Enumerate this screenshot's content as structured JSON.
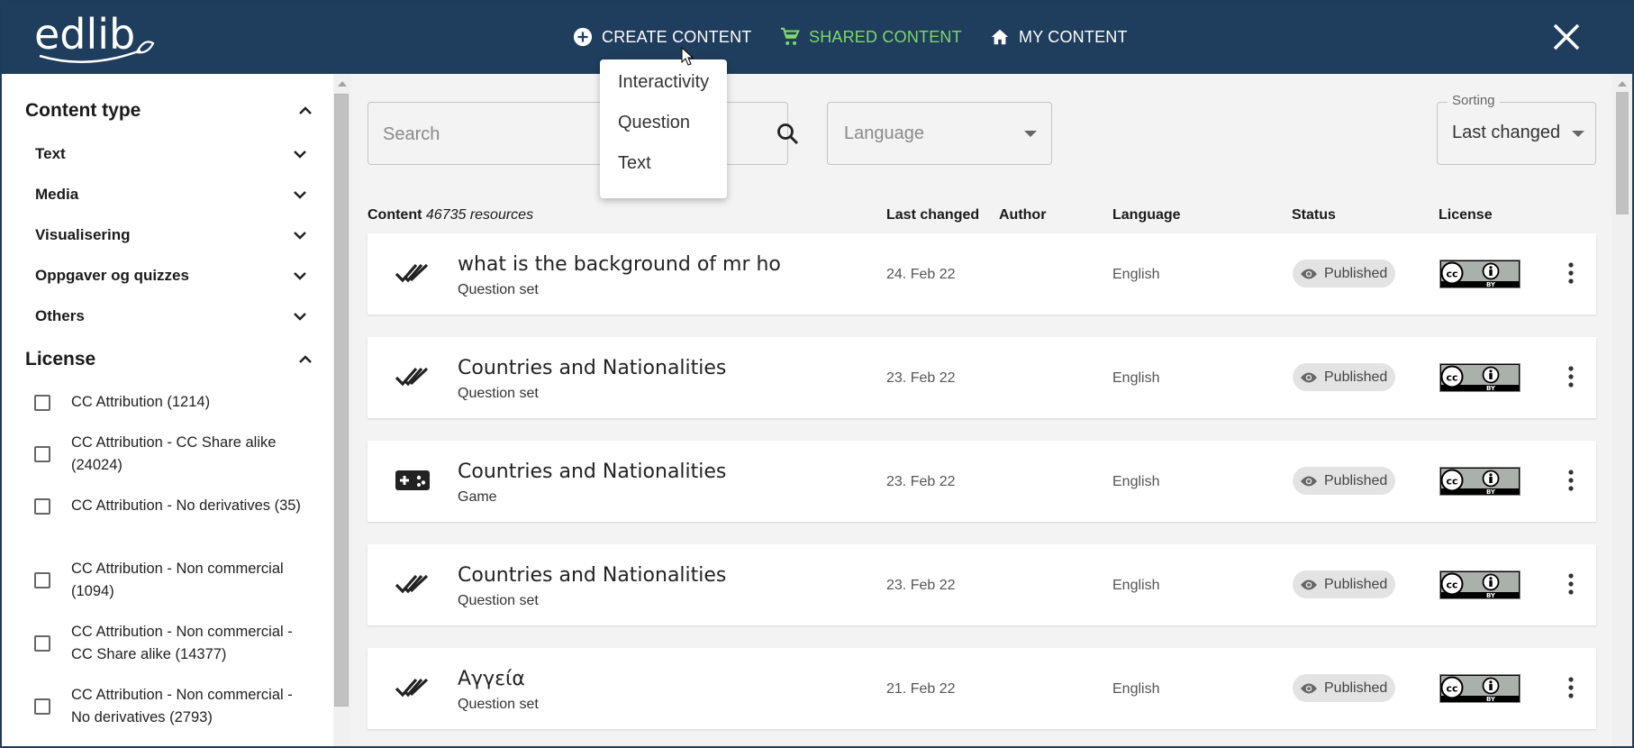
{
  "header": {
    "logo_text": "edlib",
    "nav": {
      "create": "CREATE CONTENT",
      "shared": "SHARED CONTENT",
      "mine": "MY CONTENT"
    }
  },
  "dropdown": {
    "items": [
      "Interactivity",
      "Question",
      "Text"
    ]
  },
  "sidebar": {
    "content_type": {
      "title": "Content type",
      "items": [
        "Text",
        "Media",
        "Visualisering",
        "Oppgaver og quizzes",
        "Others"
      ]
    },
    "license": {
      "title": "License",
      "items": [
        "CC Attribution (1214)",
        "CC Attribution - CC Share alike (24024)",
        "CC Attribution - No derivatives (35)",
        "CC Attribution - Non commercial (1094)",
        "CC Attribution - Non commercial - CC Share alike (14377)",
        "CC Attribution - Non commercial - No derivatives (2793)"
      ]
    }
  },
  "filters": {
    "search_placeholder": "Search",
    "language_placeholder": "Language",
    "sorting_label": "Sorting",
    "sorting_value": "Last changed"
  },
  "table": {
    "headers": {
      "content": "Content",
      "count": "46735 resources",
      "last_changed": "Last changed",
      "author": "Author",
      "language": "Language",
      "status": "Status",
      "license": "License"
    },
    "rows": [
      {
        "title": "what is the background of mr ho",
        "type": "Question set",
        "date": "24. Feb 22",
        "language": "English",
        "status": "Published",
        "icon": "question-set-icon"
      },
      {
        "title": "Countries and Nationalities",
        "type": "Question set",
        "date": "23. Feb 22",
        "language": "English",
        "status": "Published",
        "icon": "question-set-icon"
      },
      {
        "title": "Countries and Nationalities",
        "type": "Game",
        "date": "23. Feb 22",
        "language": "English",
        "status": "Published",
        "icon": "game-controller-icon"
      },
      {
        "title": "Countries and Nationalities",
        "type": "Question set",
        "date": "23. Feb 22",
        "language": "English",
        "status": "Published",
        "icon": "question-set-icon"
      },
      {
        "title": "Αγγεία",
        "type": "Question set",
        "date": "21. Feb 22",
        "language": "English",
        "status": "Published",
        "icon": "question-set-icon"
      }
    ],
    "license_badge": {
      "cc": "cc",
      "by": "BY"
    }
  },
  "colors": {
    "header_bg": "#1f3d5c",
    "shared_accent": "#7dd86a",
    "page_bg": "#f3f3f3"
  }
}
